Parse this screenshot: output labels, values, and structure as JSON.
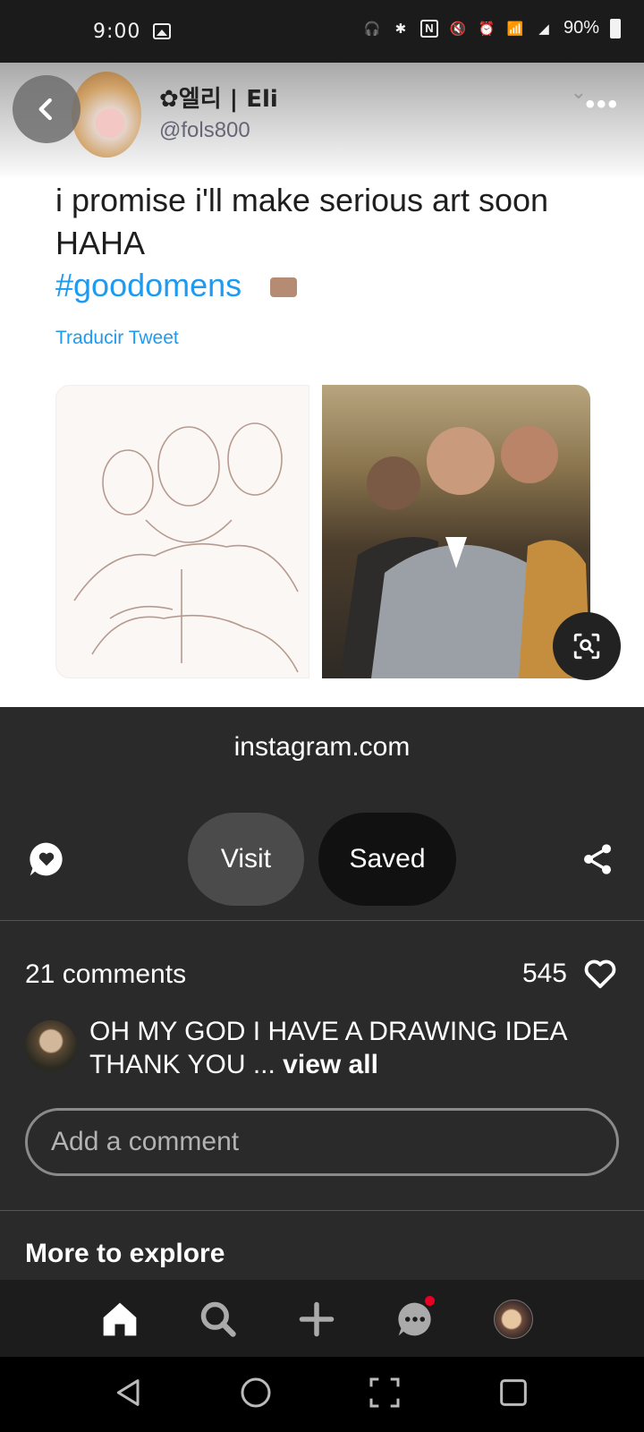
{
  "status_bar": {
    "time": "9:00",
    "battery": "90%"
  },
  "pin": {
    "author_name": "✿엘리 | Eli",
    "author_handle": "@fols800",
    "tweet_text": "i promise i'll make serious art soon HAHA",
    "hashtag": "#goodomens",
    "translate_label": "Traducir Tweet",
    "more_menu": "•••"
  },
  "actions": {
    "source": "instagram.com",
    "visit_label": "Visit",
    "saved_label": "Saved"
  },
  "comments": {
    "count_label": "21 comments",
    "likes": "545",
    "top_comment_text": "OH MY GOD I HAVE A DRAWING IDEA THANK YOU ...",
    "view_all_label": "view all",
    "input_placeholder": "Add a comment"
  },
  "more_to_explore": "More to explore",
  "colors": {
    "panel_bg": "#2a2a2a",
    "link_blue": "#1d9bf0",
    "notification_red": "#e60023"
  }
}
